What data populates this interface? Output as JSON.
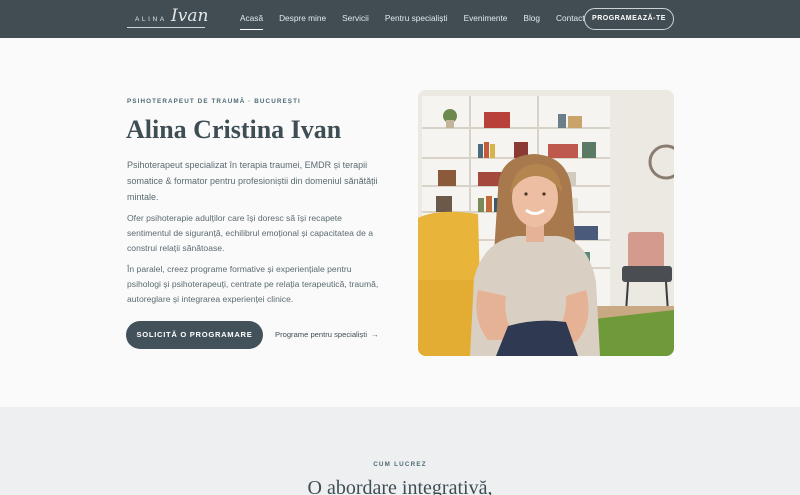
{
  "nav": {
    "logo_text": "ALINA",
    "logo_script": "Ivan",
    "items": [
      {
        "label": "Acasă",
        "active": true
      },
      {
        "label": "Despre mine",
        "active": false
      },
      {
        "label": "Servicii",
        "active": false
      },
      {
        "label": "Pentru specialiști",
        "active": false
      },
      {
        "label": "Evenimente",
        "active": false
      },
      {
        "label": "Blog",
        "active": false
      },
      {
        "label": "Contact",
        "active": false
      }
    ],
    "cta_label": "PROGRAMEAZĂ-TE"
  },
  "hero": {
    "eyebrow": "PSIHOTERAPEUT DE TRAUMĂ · BUCUREȘTI",
    "title": "Alina Cristina Ivan",
    "paragraph1": "Psihoterapeut specializat în terapia traumei, EMDR și terapii somatice & formator pentru profesioniștii din domeniul sănătății mintale.",
    "paragraph2": "Ofer psihoterapie adulților care își doresc să își recapete sentimentul de siguranță, echilibrul emoțional și capacitatea de a construi relații sănătoase.",
    "paragraph3": "În paralel, creez programe formative și experiențiale pentru psihologi și psihoterapeuți, centrate pe relația terapeutică, traumă, autoreglare și integrarea experienței clinice.",
    "primary_button": "SOLICITĂ O PROGRAMARE",
    "secondary_link": "Programe pentru specialiști",
    "secondary_arrow": "→"
  },
  "section2": {
    "eyebrow": "CUM LUCREZ",
    "title": "O abordare integrativă,"
  },
  "colors": {
    "nav_bg": "#414d53",
    "button_bg": "#43525a",
    "accent_text": "#4d6a72",
    "section2_bg": "#eeeff0"
  }
}
